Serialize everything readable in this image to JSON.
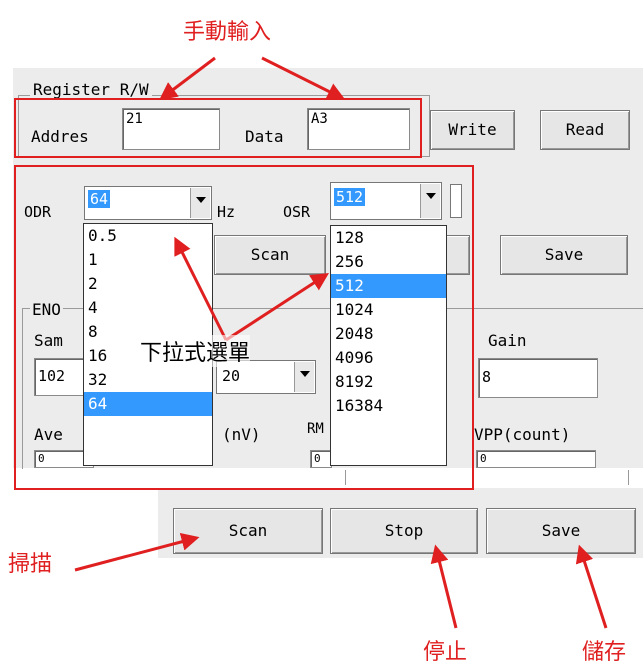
{
  "annotations": {
    "manual_input": "手動輸入",
    "dropdown_menu": "下拉式選單",
    "scan": "掃描",
    "stop": "停止",
    "save": "儲存"
  },
  "register_group": {
    "title": "Register R/W",
    "address_label": "Addres",
    "address_value": "21",
    "data_label": "Data",
    "data_value": "A3",
    "write_button": "Write",
    "read_button": "Read"
  },
  "settings": {
    "odr_label": "ODR",
    "odr_value": "64",
    "odr_unit": "Hz",
    "osr_label": "OSR",
    "osr_value": "512",
    "scan_button": "Scan",
    "save_button": "Save"
  },
  "odr_options": [
    "0.5",
    "1",
    "2",
    "4",
    "8",
    "16",
    "32",
    "64"
  ],
  "odr_selected_index": 7,
  "osr_options": [
    "128",
    "256",
    "512",
    "1024",
    "2048",
    "4096",
    "8192",
    "16384"
  ],
  "osr_selected_index": 2,
  "eno_group": {
    "title": "ENO",
    "sample_label": "Sam",
    "sample_value": "102",
    "speed_value": "20",
    "gain_label": "Gain",
    "gain_value": "8",
    "avg_label": "Ave",
    "nv_label": "(nV)",
    "rms_label": "RM",
    "vpp_label": "VPP(count)",
    "avg_value": "0",
    "rms_value": "0",
    "vpp_value": "0"
  },
  "bottom_buttons": {
    "scan": "Scan",
    "stop": "Stop",
    "save": "Save"
  },
  "colors": {
    "annotation": "#e02020",
    "selection": "#3399ff",
    "panel_bg": "#ececec"
  }
}
